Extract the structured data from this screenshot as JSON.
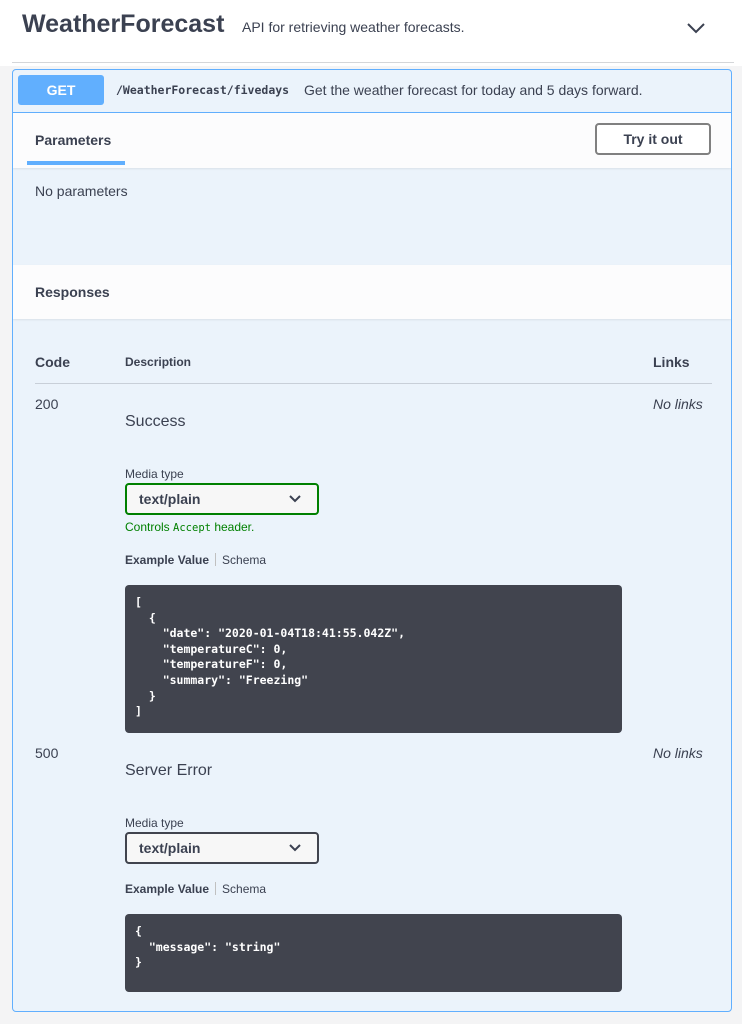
{
  "tag": {
    "title": "WeatherForecast",
    "description": "API for retrieving weather forecasts.",
    "collapse_icon": "chevron-down-icon"
  },
  "operation": {
    "method": "GET",
    "path": "/WeatherForecast/fivedays",
    "summary": "Get the weather forecast for today and 5 days forward.",
    "color": "#61affe"
  },
  "parameters": {
    "tab_label": "Parameters",
    "try_button": "Try it out",
    "empty_text": "No parameters"
  },
  "responses": {
    "title": "Responses",
    "columns": {
      "code": "Code",
      "description": "Description",
      "links": "Links"
    },
    "items": [
      {
        "code": "200",
        "description": "Success",
        "links": "No links",
        "media_type_label": "Media type",
        "media_type": "text/plain",
        "controls_prefix": "Controls",
        "controls_code": "Accept",
        "controls_suffix": "header.",
        "example_tab": "Example Value",
        "schema_tab": "Schema",
        "example": "[\n  {\n    \"date\": \"2020-01-04T18:41:55.042Z\",\n    \"temperatureC\": 0,\n    \"temperatureF\": 0,\n    \"summary\": \"Freezing\"\n  }\n]"
      },
      {
        "code": "500",
        "description": "Server Error",
        "links": "No links",
        "media_type_label": "Media type",
        "media_type": "text/plain",
        "example_tab": "Example Value",
        "schema_tab": "Schema",
        "example": "{\n  \"message\": \"string\"\n}"
      }
    ]
  }
}
